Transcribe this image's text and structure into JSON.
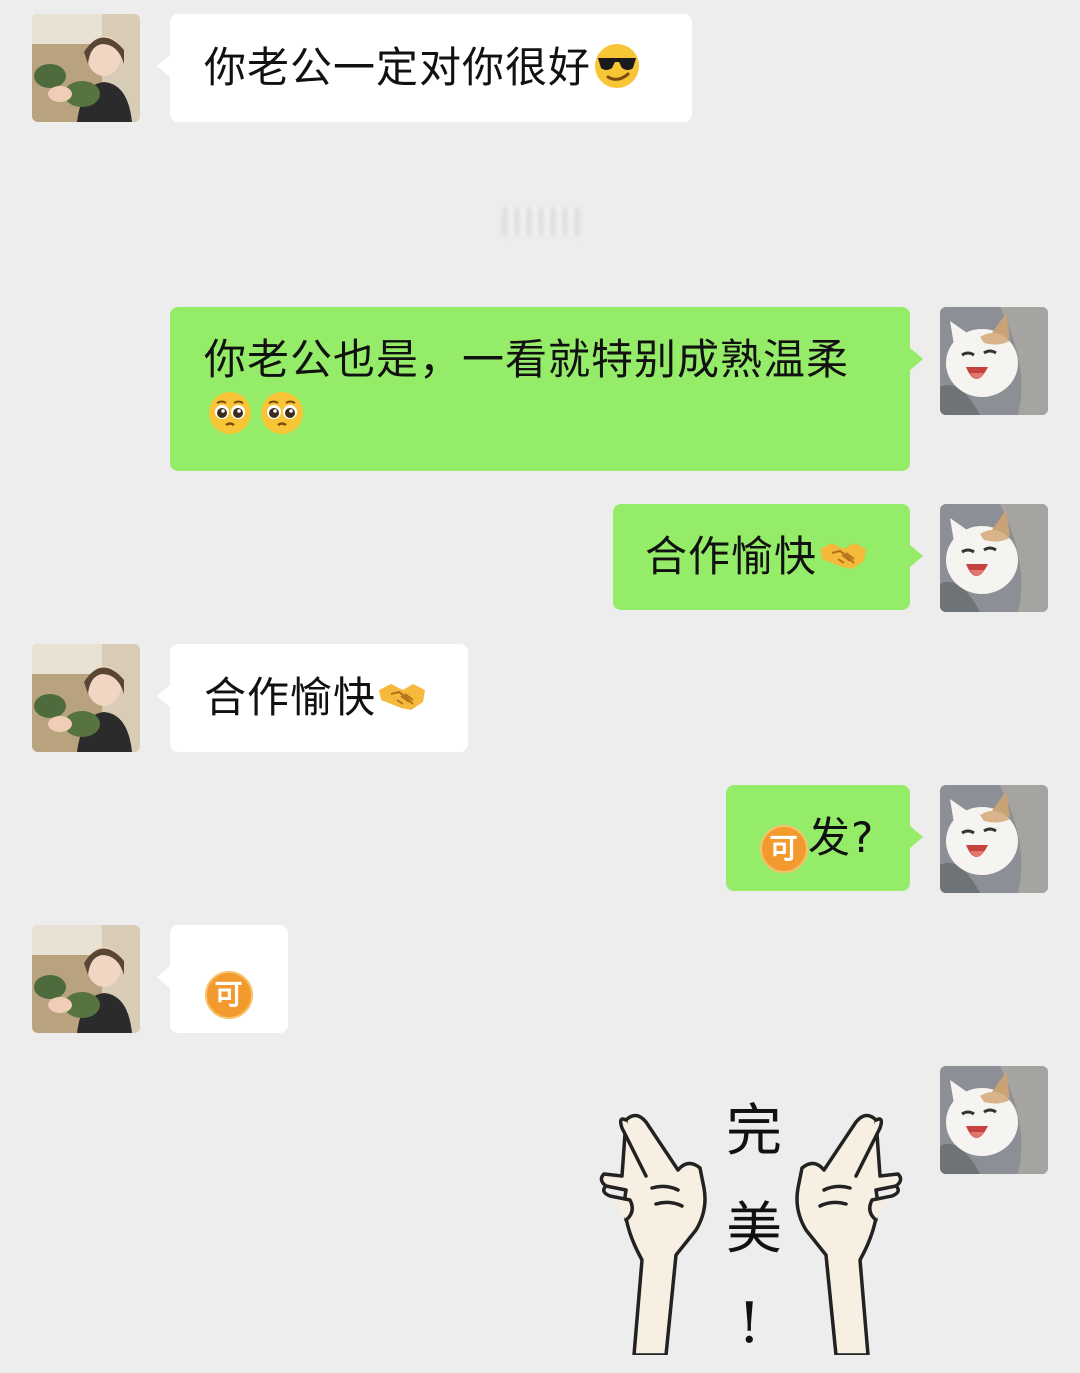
{
  "messages": [
    {
      "side": "left",
      "text": "你老公一定对你很好",
      "emoji": "sunglasses-face"
    },
    {
      "side": "right",
      "line1": "你老公也是，一看就特别成熟温柔",
      "emoji": "pleading-face"
    },
    {
      "side": "right",
      "text": "合作愉快",
      "emoji": "handshake"
    },
    {
      "side": "left",
      "text": "合作愉快",
      "emoji": "handshake"
    },
    {
      "side": "right",
      "badge": "可",
      "text": "发?"
    },
    {
      "side": "left",
      "badge": "可"
    },
    {
      "side": "right",
      "sticker_text": [
        "完",
        "美",
        "!"
      ]
    }
  ],
  "colors": {
    "background": "#ededed",
    "self_bubble": "#95ec69",
    "other_bubble": "#ffffff",
    "badge": "#f39a2e"
  }
}
